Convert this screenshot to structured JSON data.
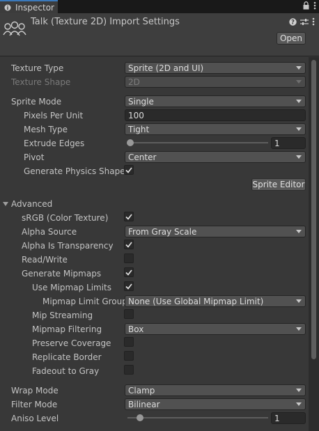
{
  "tab": {
    "title": "Inspector"
  },
  "header": {
    "title": "Talk (Texture 2D) Import Settings",
    "open_label": "Open"
  },
  "texture_type": {
    "label": "Texture Type",
    "value": "Sprite (2D and UI)"
  },
  "texture_shape": {
    "label": "Texture Shape",
    "value": "2D"
  },
  "sprite_mode": {
    "label": "Sprite Mode",
    "value": "Single"
  },
  "pixels_per_unit": {
    "label": "Pixels Per Unit",
    "value": "100"
  },
  "mesh_type": {
    "label": "Mesh Type",
    "value": "Tight"
  },
  "extrude_edges": {
    "label": "Extrude Edges",
    "value": "1",
    "fraction": 0.02
  },
  "pivot": {
    "label": "Pivot",
    "value": "Center"
  },
  "generate_physics_shape": {
    "label": "Generate Physics Shape",
    "checked": true
  },
  "sprite_editor": {
    "label": "Sprite Editor"
  },
  "advanced": {
    "label": "Advanced",
    "srgb": {
      "label": "sRGB (Color Texture)",
      "checked": true
    },
    "alpha_source": {
      "label": "Alpha Source",
      "value": "From Gray Scale"
    },
    "alpha_is_transparency": {
      "label": "Alpha Is Transparency",
      "checked": true
    },
    "read_write": {
      "label": "Read/Write",
      "checked": false
    },
    "generate_mipmaps": {
      "label": "Generate Mipmaps",
      "checked": true
    },
    "use_mipmap_limits": {
      "label": "Use Mipmap Limits",
      "checked": true
    },
    "mipmap_limit_group": {
      "label": "Mipmap Limit Group",
      "value": "None (Use Global Mipmap Limit)"
    },
    "mip_streaming": {
      "label": "Mip Streaming",
      "checked": false
    },
    "mipmap_filtering": {
      "label": "Mipmap Filtering",
      "value": "Box"
    },
    "preserve_coverage": {
      "label": "Preserve Coverage",
      "checked": false
    },
    "replicate_border": {
      "label": "Replicate Border",
      "checked": false
    },
    "fadeout_to_gray": {
      "label": "Fadeout to Gray",
      "checked": false
    }
  },
  "wrap_mode": {
    "label": "Wrap Mode",
    "value": "Clamp"
  },
  "filter_mode": {
    "label": "Filter Mode",
    "value": "Bilinear"
  },
  "aniso_level": {
    "label": "Aniso Level",
    "value": "1",
    "fraction": 0.09
  }
}
